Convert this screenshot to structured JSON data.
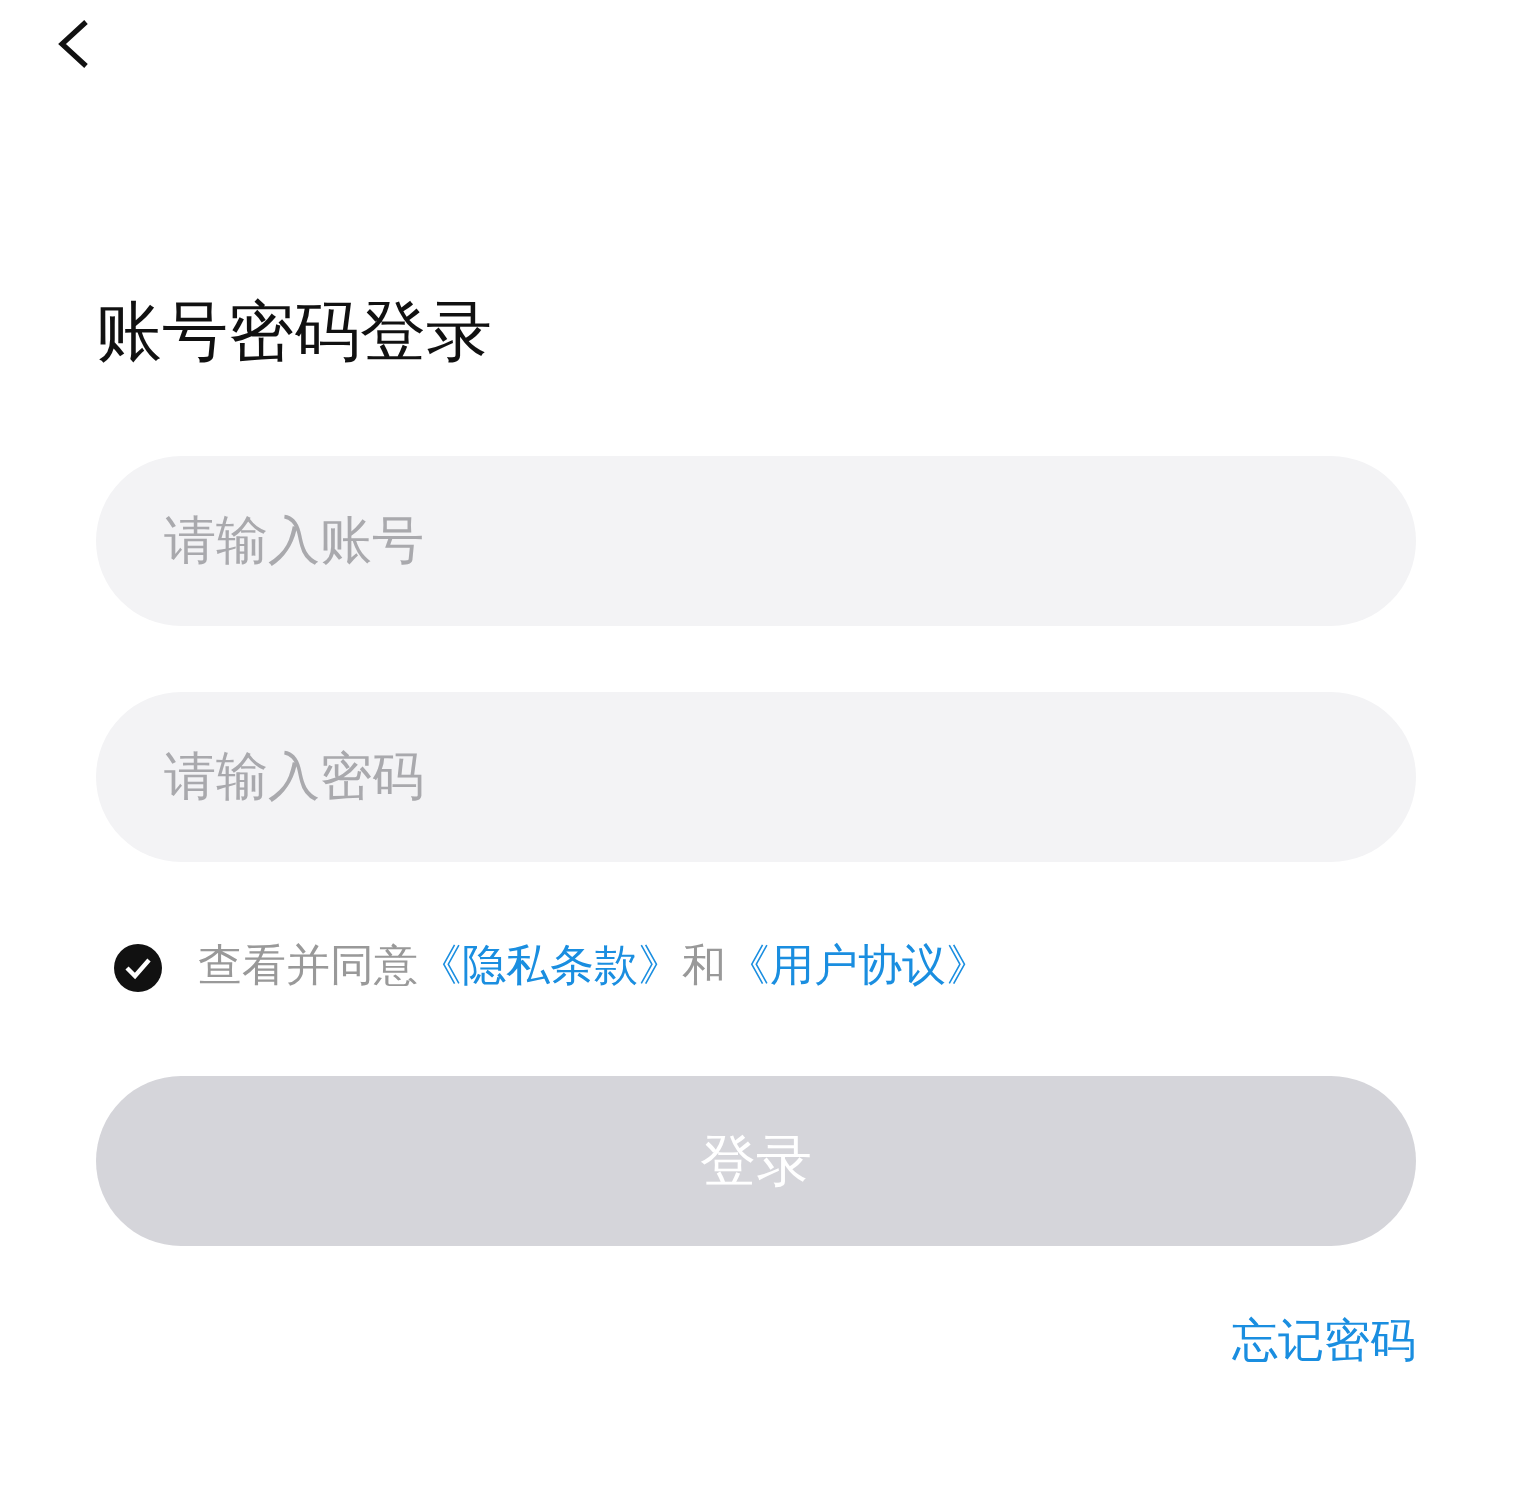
{
  "title": "账号密码登录",
  "fields": [
    {
      "placeholder": "请输入账号"
    },
    {
      "placeholder": "请输入密码"
    }
  ],
  "agreement": {
    "checked": true,
    "parts": [
      {
        "kind": "text",
        "text": "查看并同意"
      },
      {
        "kind": "link",
        "text": "《隐私条款》"
      },
      {
        "kind": "text",
        "text": "和"
      },
      {
        "kind": "link",
        "text": "《用户协议》"
      }
    ]
  },
  "login_button": {
    "label": "登录",
    "disabled": true
  },
  "forgot_link": "忘记密码"
}
